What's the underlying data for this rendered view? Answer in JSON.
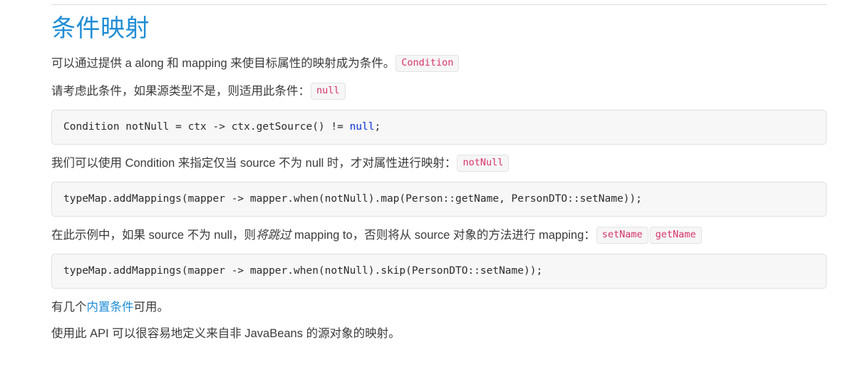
{
  "theme": {
    "accent_blue": "#1f8dd6",
    "inline_code_color": "#d6336c",
    "code_bg": "#f7f7f7",
    "code_border": "#e1e1e1",
    "text_color": "#3b3b3b",
    "keyword_color": "#0b31d6",
    "divider_color": "#dddddd"
  },
  "heading": {
    "title": "条件映射"
  },
  "paragraphs": {
    "p1": {
      "text": "可以通过提供 a along 和 mapping 来使目标属性的映射成为条件。",
      "badge": "Condition"
    },
    "p2": {
      "text": "请考虑此条件，如果源类型不是，则适用此条件：",
      "badge": "null"
    },
    "p3": {
      "text": "我们可以使用 Condition 来指定仅当 source 不为 null 时，才对属性进行映射：",
      "badge": "notNull"
    },
    "p4": {
      "text_before_italic": "在此示例中，如果 source 不为 null，则",
      "italic_text": "将跳过",
      "text_after_italic": " mapping to，否则将从 source 对象的方法进行 mapping：",
      "badge_1": "setName",
      "badge_2": "getName"
    },
    "p5": {
      "text_before_link": "有几个",
      "link_text": "内置条件",
      "text_after_link": "可用。"
    },
    "p6": {
      "text": "使用此 API 可以很容易地定义来自非 JavaBeans 的源对象的映射。"
    }
  },
  "code_blocks": {
    "block1": {
      "prefix": "Condition notNull = ctx -> ctx.getSource() != ",
      "keyword": "null",
      "suffix": ";"
    },
    "block2": {
      "code": "typeMap.addMappings(mapper -> mapper.when(notNull).map(Person::getName, PersonDTO::setName));"
    },
    "block3": {
      "code": "typeMap.addMappings(mapper -> mapper.when(notNull).skip(PersonDTO::setName));"
    }
  }
}
